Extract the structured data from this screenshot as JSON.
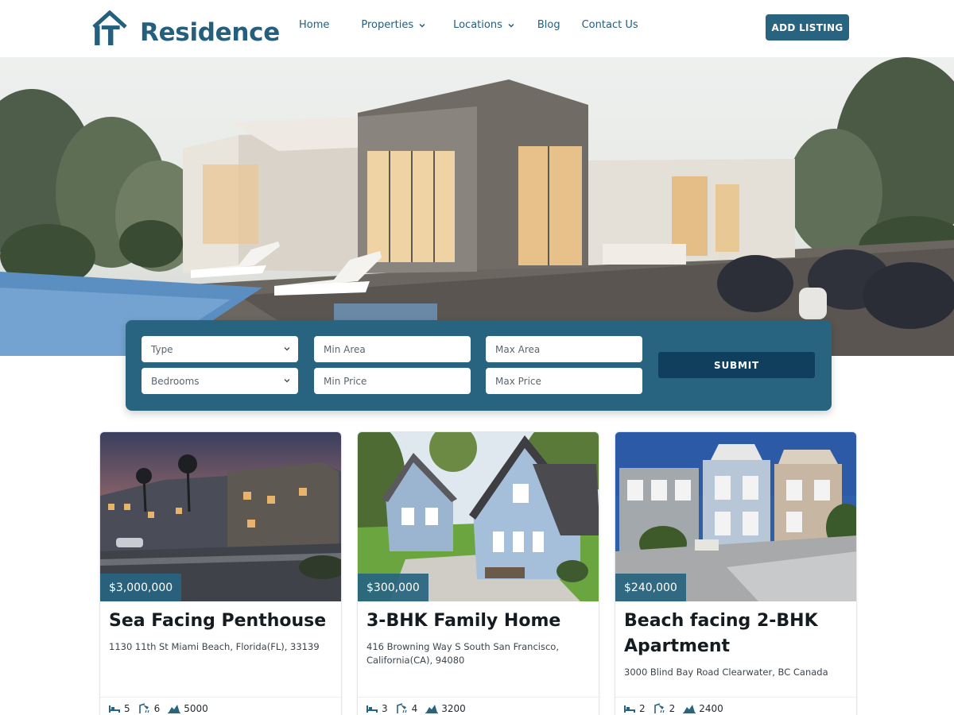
{
  "brand": {
    "logo_mark": "IT",
    "name": "Residence"
  },
  "nav": {
    "items": [
      {
        "label": "Home",
        "dropdown": false
      },
      {
        "label": "Properties",
        "dropdown": true
      },
      {
        "label": "Locations",
        "dropdown": true
      },
      {
        "label": "Blog",
        "dropdown": false
      },
      {
        "label": "Contact Us",
        "dropdown": false
      }
    ],
    "cta_label": "ADD LISTING"
  },
  "search": {
    "type_select": "Type",
    "bedrooms_select": "Bedrooms",
    "min_area_placeholder": "Min Area",
    "max_area_placeholder": "Max Area",
    "min_price_placeholder": "Min Price",
    "max_price_placeholder": "Max Price",
    "submit_label": "SUBMIT"
  },
  "listings": [
    {
      "price": "$3,000,000",
      "title": "Sea Facing Penthouse",
      "address": "1130 11th St Miami Beach, Florida(FL), 33139",
      "beds": "5",
      "baths": "6",
      "area": "5000"
    },
    {
      "price": "$300,000",
      "title": "3-BHK Family Home",
      "address": "416 Browning Way S South San Francisco, California(CA), 94080",
      "beds": "3",
      "baths": "4",
      "area": "3200"
    },
    {
      "price": "$240,000",
      "title": "Beach facing 2-BHK Apartment",
      "address": "3000 Blind Bay Road Clearwater, BC Canada",
      "beds": "2",
      "baths": "2",
      "area": "2400"
    }
  ],
  "icons": {
    "logo": "house-roof-icon",
    "dropdown": "chevron-down-icon",
    "beds": "bed-icon",
    "baths": "shower-icon",
    "area": "area-chart-icon"
  },
  "colors": {
    "brand_primary": "#286480",
    "brand_dark": "#0f3f5c",
    "text_dark": "#141c22",
    "nav_text": "#245f7d"
  }
}
